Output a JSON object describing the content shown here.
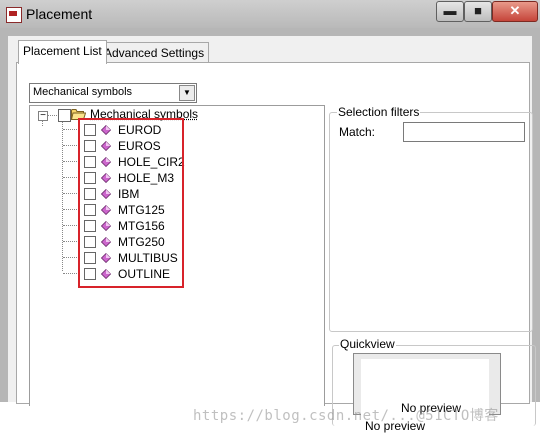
{
  "window": {
    "title": "Placement",
    "controls": {
      "minimize": "▬",
      "maximize": "■",
      "close": "✕"
    }
  },
  "tabs": [
    {
      "label": "Placement List",
      "active": true
    },
    {
      "label": "Advanced Settings",
      "active": false
    }
  ],
  "category_select": {
    "value": "Mechanical symbols",
    "arrow": "▼"
  },
  "tree": {
    "expander": "−",
    "root": {
      "label": "Mechanical symbols",
      "icon": "folder-open-icon",
      "checked": false
    },
    "items": [
      {
        "label": "EUROD",
        "checked": false,
        "icon": "symbol-gem-icon"
      },
      {
        "label": "EUROS",
        "checked": false,
        "icon": "symbol-gem-icon"
      },
      {
        "label": "HOLE_CIR2",
        "checked": false,
        "icon": "symbol-gem-icon"
      },
      {
        "label": "HOLE_M3",
        "checked": false,
        "icon": "symbol-gem-icon"
      },
      {
        "label": "IBM",
        "checked": false,
        "icon": "symbol-gem-icon"
      },
      {
        "label": "MTG125",
        "checked": false,
        "icon": "symbol-gem-icon"
      },
      {
        "label": "MTG156",
        "checked": false,
        "icon": "symbol-gem-icon"
      },
      {
        "label": "MTG250",
        "checked": false,
        "icon": "symbol-gem-icon"
      },
      {
        "label": "MULTIBUS",
        "checked": false,
        "icon": "symbol-gem-icon"
      },
      {
        "label": "OUTLINE",
        "checked": false,
        "icon": "symbol-gem-icon"
      }
    ]
  },
  "selection_filters": {
    "title": "Selection filters",
    "match_label": "Match:",
    "match_value": ""
  },
  "quickview": {
    "title": "Quickview",
    "preview_text_1": "No preview",
    "preview_text_2": "No preview"
  },
  "watermark": "https://blog.csdn.net/...@51CTO博客",
  "colors": {
    "highlight": "#d8232a",
    "gem": "#cc66cc"
  }
}
